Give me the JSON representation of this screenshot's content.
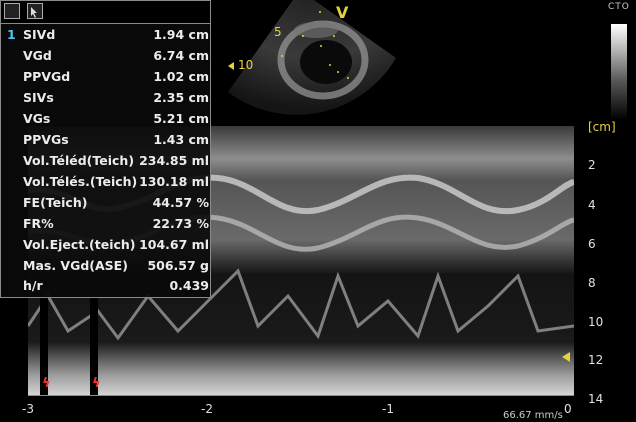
{
  "panel": {
    "index": "1",
    "rows": [
      {
        "name": "SIVd",
        "value": "1.94 cm"
      },
      {
        "name": "VGd",
        "value": "6.74 cm"
      },
      {
        "name": "PPVGd",
        "value": "1.02 cm"
      },
      {
        "name": "SIVs",
        "value": "2.35 cm"
      },
      {
        "name": "VGs",
        "value": "5.21 cm"
      },
      {
        "name": "PPVGs",
        "value": "1.43 cm"
      },
      {
        "name": "Vol.Téléd(Teich)",
        "value": "234.85 ml"
      },
      {
        "name": "Vol.Télés.(Teich)",
        "value": "130.18 ml"
      },
      {
        "name": "FE(Teich)",
        "value": "44.57 %"
      },
      {
        "name": "FR%",
        "value": "22.73 %"
      },
      {
        "name": "Vol.Eject.(teich)",
        "value": "104.67 ml"
      },
      {
        "name": "Mas. VGd(ASE)",
        "value": "506.57 g"
      },
      {
        "name": "h/r",
        "value": "0.439"
      }
    ]
  },
  "sector": {
    "label": "V",
    "depth_ticks": [
      "5",
      "10"
    ]
  },
  "cto_label": "CTO",
  "depth_axis": {
    "unit": "[cm]",
    "labels": [
      "2",
      "4",
      "6",
      "8",
      "10",
      "12",
      "14"
    ]
  },
  "time_axis": {
    "labels": [
      "-3",
      "-2",
      "-1",
      "0"
    ],
    "speed": "66.67 mm/s"
  },
  "colors": {
    "accent": "#e8d23a",
    "ecg_marker": "#ff3030",
    "index": "#4fc3f7",
    "baseline": "#2fb6a8"
  }
}
